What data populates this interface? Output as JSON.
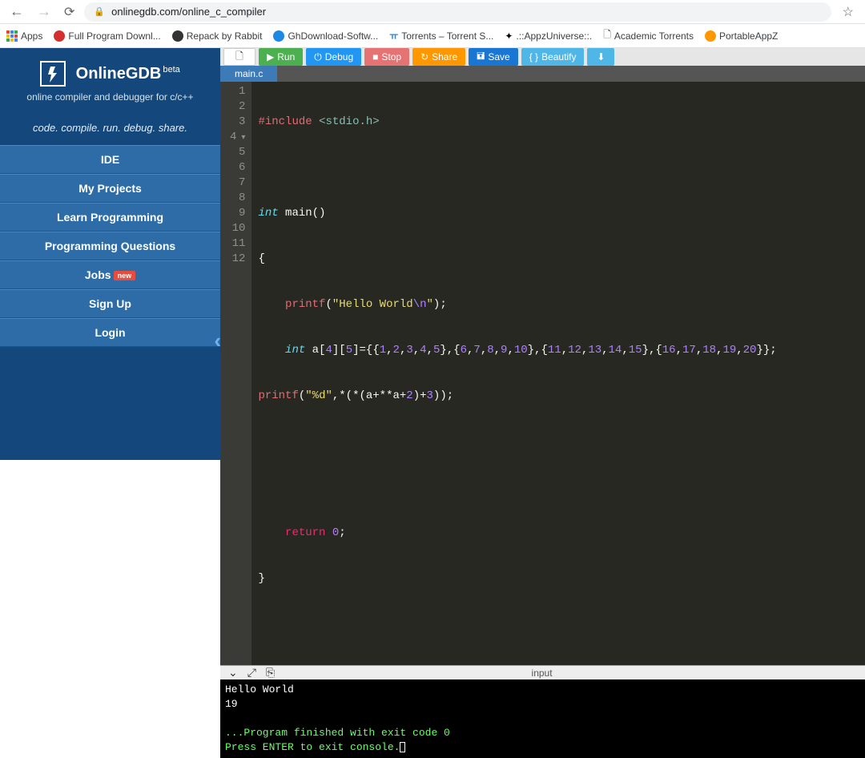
{
  "browser": {
    "url": "onlinegdb.com/online_c_compiler"
  },
  "bookmarks": [
    {
      "label": "Apps"
    },
    {
      "label": "Full Program Downl..."
    },
    {
      "label": "Repack by Rabbit"
    },
    {
      "label": "GhDownload-Softw..."
    },
    {
      "label": "Torrents – Torrent S..."
    },
    {
      "label": ".::AppzUniverse::."
    },
    {
      "label": "Academic Torrents"
    },
    {
      "label": "PortableAppZ"
    }
  ],
  "sidebar": {
    "title": "OnlineGDB",
    "beta": "beta",
    "subtitle": "online compiler and debugger for c/c++",
    "tagline": "code. compile. run. debug. share.",
    "items": [
      {
        "label": "IDE"
      },
      {
        "label": "My Projects"
      },
      {
        "label": "Learn Programming"
      },
      {
        "label": "Programming Questions"
      },
      {
        "label": "Jobs",
        "badge": "new"
      },
      {
        "label": "Sign Up"
      },
      {
        "label": "Login"
      }
    ]
  },
  "toolbar": {
    "run": "Run",
    "debug": "Debug",
    "stop": "Stop",
    "share": "Share",
    "save": "Save",
    "beautify": "Beautify"
  },
  "file_tab": "main.c",
  "code": {
    "gutter": [
      "1",
      "2",
      "3",
      "4",
      "5",
      "6",
      "7",
      "8",
      "9",
      "10",
      "11",
      "12"
    ],
    "l1_a": "#include ",
    "l1_b": "<stdio.h>",
    "l3_a": "int",
    "l3_b": " main()",
    "l4": "{",
    "l5_a": "    ",
    "l5_b": "printf",
    "l5_c": "(",
    "l5_d": "\"Hello World",
    "l5_e": "\\n",
    "l5_f": "\"",
    "l5_g": ");",
    "l6_a": "    ",
    "l6_b": "int",
    "l6_c": " a[",
    "l6_d": "4",
    "l6_e": "][",
    "l6_f": "5",
    "l6_g": "]={{",
    "l6_n1": "1",
    "l6_c1": ",",
    "l6_n2": "2",
    "l6_c2": ",",
    "l6_n3": "3",
    "l6_c3": ",",
    "l6_n4": "4",
    "l6_c4": ",",
    "l6_n5": "5",
    "l6_g2": "},{",
    "l6_n6": "6",
    "l6_c5": ",",
    "l6_n7": "7",
    "l6_c6": ",",
    "l6_n8": "8",
    "l6_c7": ",",
    "l6_n9": "9",
    "l6_c8": ",",
    "l6_n10": "10",
    "l6_g3": "},{",
    "l6_n11": "11",
    "l6_c9": ",",
    "l6_n12": "12",
    "l6_c10": ",",
    "l6_n13": "13",
    "l6_c11": ",",
    "l6_n14": "14",
    "l6_c12": ",",
    "l6_n15": "15",
    "l6_g4": "},{",
    "l6_n16": "16",
    "l6_c13": ",",
    "l6_n17": "17",
    "l6_c14": ",",
    "l6_n18": "18",
    "l6_c15": ",",
    "l6_n19": "19",
    "l6_c16": ",",
    "l6_n20": "20",
    "l6_g5": "}};",
    "l7_a": "printf",
    "l7_b": "(",
    "l7_c": "\"%d\"",
    "l7_d": ",*(*(a+**a+",
    "l7_e": "2",
    "l7_f": ")+",
    "l7_g": "3",
    "l7_h": "));",
    "l10_a": "    ",
    "l10_b": "return",
    "l10_c": " ",
    "l10_d": "0",
    "l10_e": ";",
    "l11": "}"
  },
  "console": {
    "label": "input",
    "line1": "Hello World",
    "line2": "19",
    "line4": "...Program finished with exit code 0",
    "line5": "Press ENTER to exit console."
  }
}
